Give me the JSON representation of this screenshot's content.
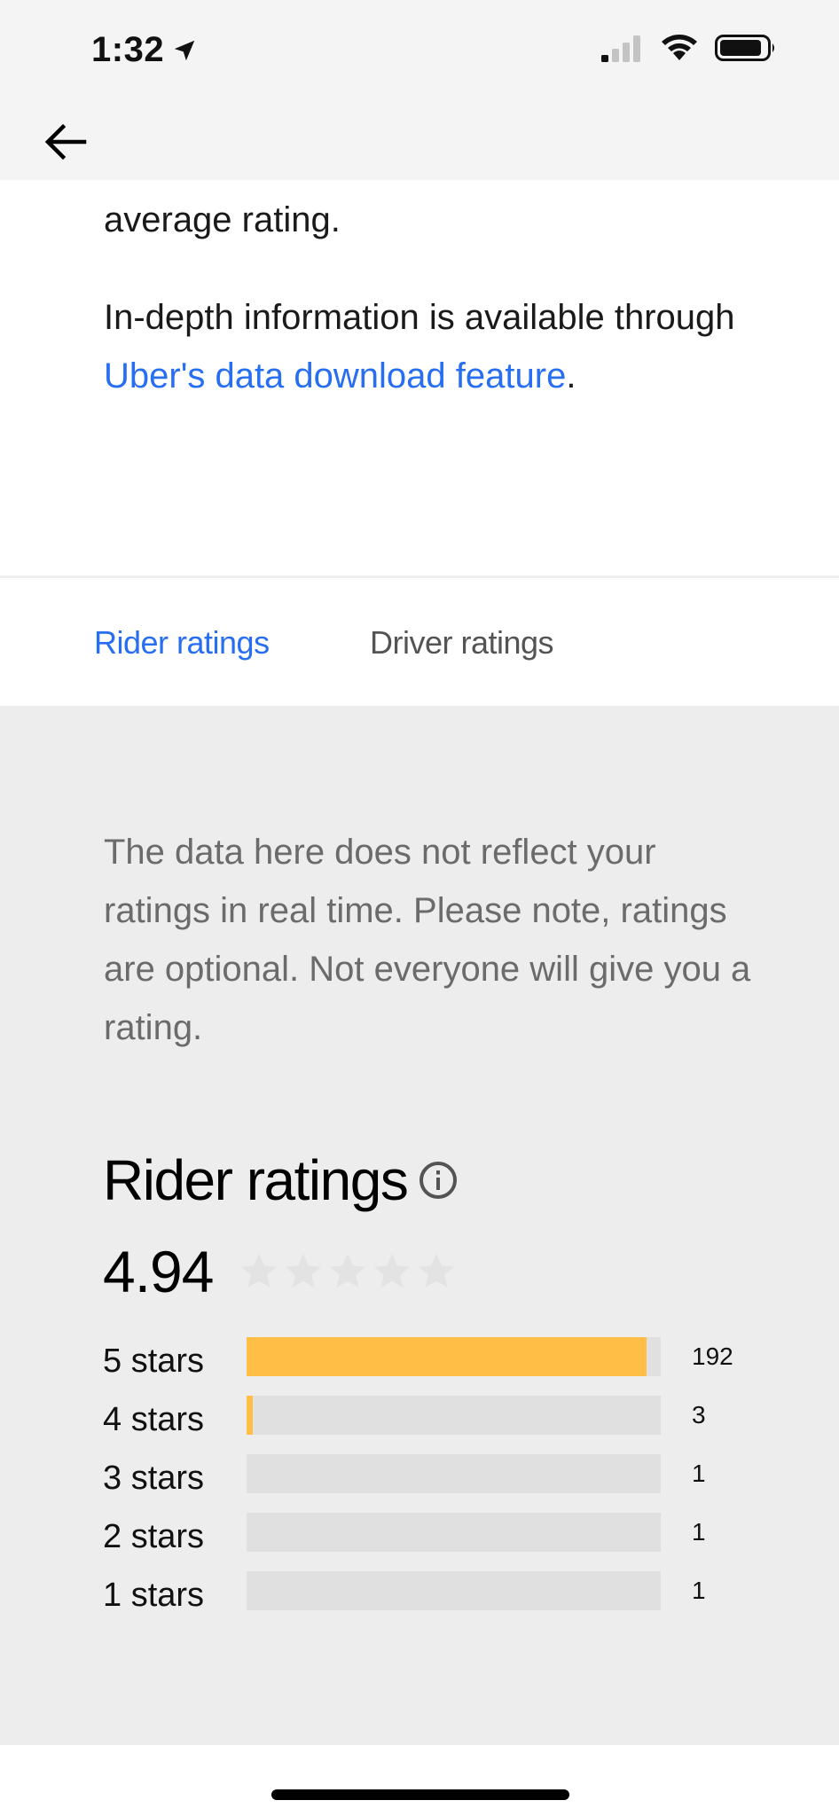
{
  "status_bar": {
    "time": "1:32",
    "location_icon": "location-arrow-icon",
    "signal_icon": "cellular-signal-icon",
    "wifi_icon": "wifi-icon",
    "battery_icon": "battery-icon"
  },
  "nav": {
    "back_icon": "arrow-left-icon"
  },
  "intro": {
    "text_1": "average rating.",
    "text_2_prefix": "In-depth information is available through ",
    "link_text": "Uber's data download feature",
    "text_2_suffix": "."
  },
  "tabs": [
    {
      "label": "Rider ratings",
      "active": true
    },
    {
      "label": "Driver ratings",
      "active": false
    }
  ],
  "notice": "The data here does not reflect your ratings in real time. Please note, ratings are optional. Not everyone will give you a rating.",
  "ratings": {
    "title": "Rider ratings",
    "info_icon": "info-circle-icon",
    "average": "4.94",
    "star_count": 5,
    "distribution": [
      {
        "label": "5 stars",
        "count": "192",
        "fill_fraction": 0.965
      },
      {
        "label": "4 stars",
        "count": "3",
        "fill_fraction": 0.015
      },
      {
        "label": "3 stars",
        "count": "1",
        "fill_fraction": 0
      },
      {
        "label": "2 stars",
        "count": "1",
        "fill_fraction": 0
      },
      {
        "label": "1 stars",
        "count": "1",
        "fill_fraction": 0
      }
    ]
  },
  "colors": {
    "link": "#276ef1",
    "bar_fill": "#ffbf47",
    "bar_track": "#e0e0e0",
    "content_bg": "#ededed",
    "header_bg": "#f4f4f4",
    "star_empty": "#e3e3e3"
  }
}
